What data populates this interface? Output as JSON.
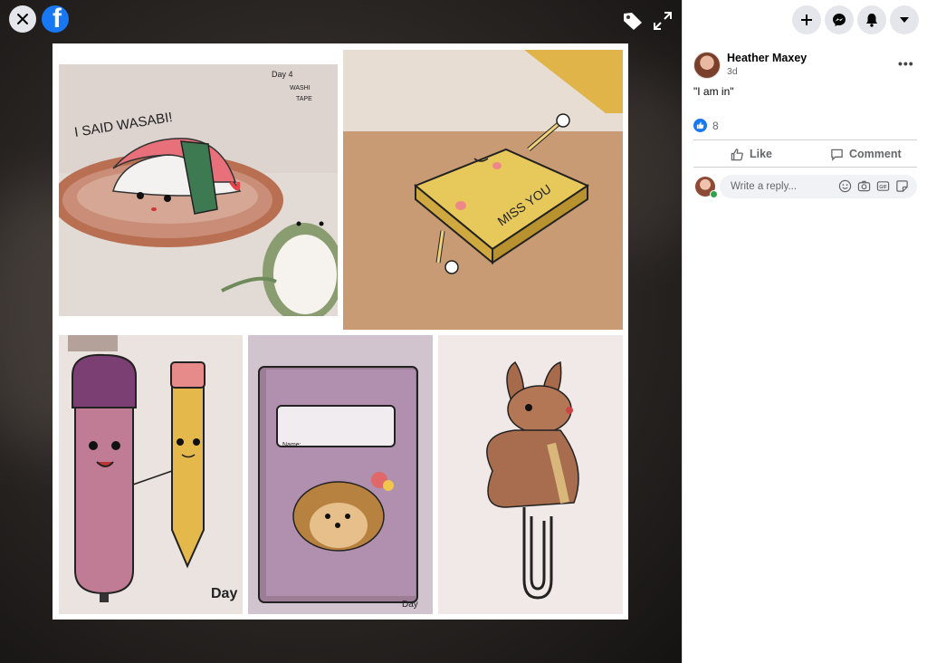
{
  "post": {
    "author_name": "Heather Maxey",
    "time": "3d",
    "text": "\"I am in\"",
    "like_count": "8"
  },
  "actions": {
    "like_label": "Like",
    "comment_label": "Comment"
  },
  "reply": {
    "placeholder": "Write a reply..."
  },
  "photo": {
    "panel_texts": {
      "day4_label": "Day 4\nWASHI\nTAPE",
      "wasabi_caption": "I SAID WASABI!",
      "miss_you": "MISS YOU",
      "notebook_name": "Name:",
      "day_label_pencil": "Day",
      "day_label_notebook": "Day"
    }
  },
  "colors": {
    "facebook_blue": "#1877f2",
    "button_gray": "#e4e6eb",
    "text_secondary": "#65676b",
    "online_green": "#31a24c"
  },
  "icons": {
    "close": "close-icon",
    "logo": "facebook-logo-icon",
    "tag": "tag-icon",
    "expand": "expand-icon",
    "create": "plus-icon",
    "messenger": "messenger-icon",
    "notifications": "bell-icon",
    "account": "caret-down-icon"
  }
}
